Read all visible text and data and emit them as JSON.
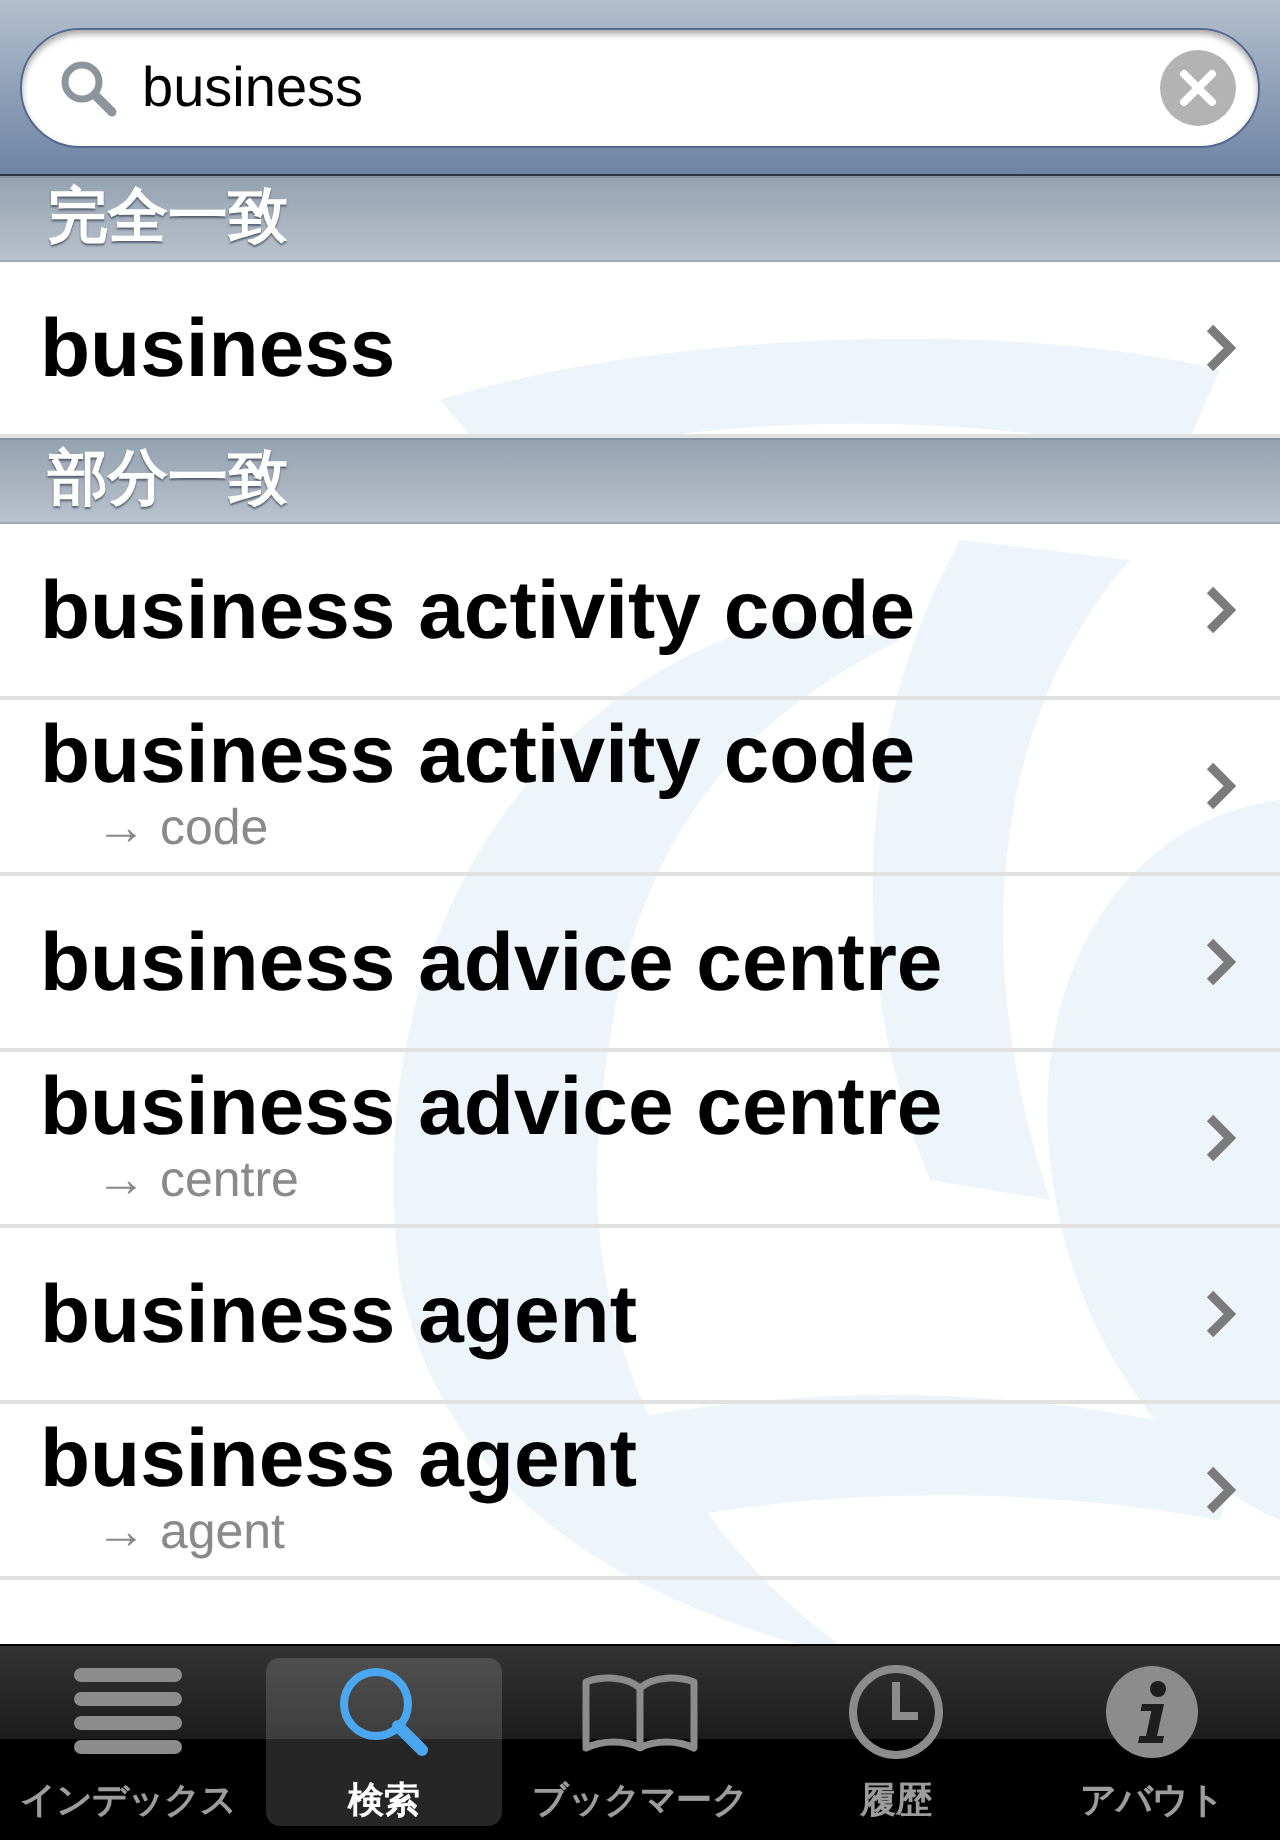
{
  "search": {
    "value": "business"
  },
  "sections": [
    {
      "title": "完全一致",
      "rows": [
        {
          "term": "business"
        }
      ]
    },
    {
      "title": "部分一致",
      "rows": [
        {
          "term": "business activity code"
        },
        {
          "term": "business activity code",
          "see": "→ code"
        },
        {
          "term": "business advice centre"
        },
        {
          "term": "business advice centre",
          "see": "→ centre"
        },
        {
          "term": "business agent"
        },
        {
          "term": "business agent",
          "see": "→ agent"
        }
      ]
    }
  ],
  "tabs": [
    {
      "label": "インデックス",
      "selected": false
    },
    {
      "label": "検索",
      "selected": true
    },
    {
      "label": "ブックマーク",
      "selected": false
    },
    {
      "label": "履歴",
      "selected": false
    },
    {
      "label": "アバウト",
      "selected": false
    }
  ]
}
